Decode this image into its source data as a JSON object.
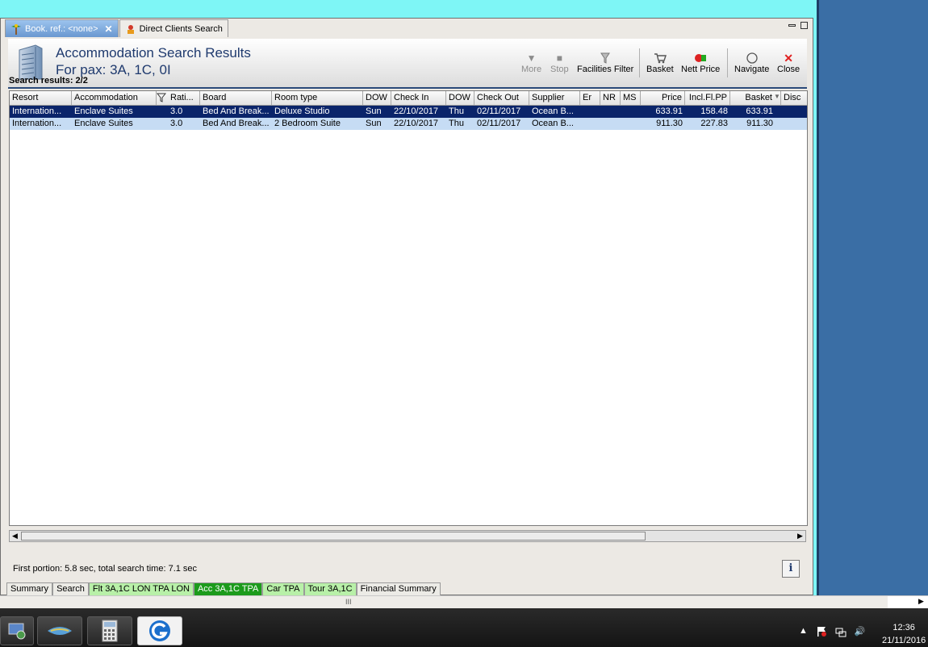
{
  "tabs": [
    {
      "label": "Book. ref.: <none>"
    },
    {
      "label": "Direct Clients Search"
    }
  ],
  "header": {
    "title": "Accommodation Search Results",
    "subtitle": "For pax: 3A, 1C, 0I"
  },
  "toolbar": {
    "more": "More",
    "stop": "Stop",
    "facilities_filter": "Facilities Filter",
    "basket": "Basket",
    "nett_price": "Nett Price",
    "navigate": "Navigate",
    "close": "Close"
  },
  "results_label": "Search results: 2/2",
  "table": {
    "columns": [
      "Resort",
      "Accommodation",
      "Rati...",
      "Board",
      "Room type",
      "DOW",
      "Check In",
      "DOW",
      "Check Out",
      "Supplier",
      "Er",
      "NR",
      "MS",
      "Price",
      "Incl.Fl.PP",
      "Basket",
      "Disc"
    ],
    "rows": [
      [
        "Internation...",
        "Enclave Suites",
        "3.0",
        "Bed And Break...",
        "Deluxe Studio",
        "Sun",
        "22/10/2017",
        "Thu",
        "02/11/2017",
        "Ocean B...",
        "",
        "",
        "",
        "633.91",
        "158.48",
        "633.91",
        ""
      ],
      [
        "Internation...",
        "Enclave Suites",
        "3.0",
        "Bed And Break...",
        "2 Bedroom Suite",
        "Sun",
        "22/10/2017",
        "Thu",
        "02/11/2017",
        "Ocean B...",
        "",
        "",
        "",
        "911.30",
        "227.83",
        "911.30",
        ""
      ]
    ]
  },
  "status_text": "First portion: 5.8 sec, total search time: 7.1 sec",
  "info_button": "i",
  "bottom_tabs": [
    {
      "label": "Summary"
    },
    {
      "label": "Search"
    },
    {
      "label": "Flt 3A,1C LON TPA LON"
    },
    {
      "label": "Acc 3A,1C TPA"
    },
    {
      "label": "Car TPA"
    },
    {
      "label": "Tour 3A,1C"
    },
    {
      "label": "Financial Summary"
    }
  ],
  "scroll_grip": "III",
  "clock": {
    "time": "12:36",
    "date": "21/11/2016"
  },
  "colors": {
    "selected_row": "#0a246a",
    "alt_row": "#c6dcf4",
    "header_text": "#1f3a6e",
    "flight_tab": "#b8f0a8",
    "acc_tab": "#1c9b1c"
  }
}
